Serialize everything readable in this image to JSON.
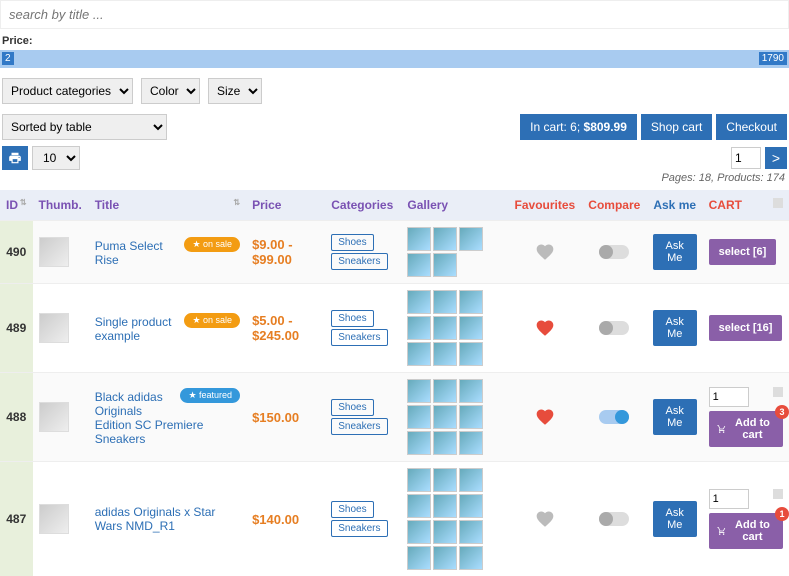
{
  "search": {
    "placeholder": "search by title ..."
  },
  "price": {
    "label": "Price:",
    "min": "2",
    "max": "1790"
  },
  "filters": {
    "categories": "Product categories",
    "color": "Color",
    "size": "Size"
  },
  "sort": "Sorted by table",
  "cart_summary": {
    "text": "In cart: 6; ",
    "price": "$809.99",
    "shop": "Shop cart",
    "checkout": "Checkout"
  },
  "per_page": "10",
  "pagination": {
    "page": "1",
    "go": ">",
    "info": "Pages: 18, Products: 174"
  },
  "columns": {
    "id": "ID",
    "thumb": "Thumb.",
    "title": "Title",
    "price": "Price",
    "categories": "Categories",
    "gallery": "Gallery",
    "favourites": "Favourites",
    "compare": "Compare",
    "askme": "Ask me",
    "cart": "CART"
  },
  "badges": {
    "sale": "★ on sale",
    "featured": "★ featured"
  },
  "cat_tags": {
    "shoes": "Shoes",
    "sneakers": "Sneakers"
  },
  "ask_label": "Ask Me",
  "addcart_label": "Add to cart",
  "rows": [
    {
      "id": "490",
      "title": "Puma Select Rise",
      "price": "$9.00 - $99.00",
      "badge": "sale",
      "gallery_count": 5,
      "fav": false,
      "compare": false,
      "cart_type": "select",
      "select_label": "select [6]"
    },
    {
      "id": "489",
      "title": "Single product example",
      "price": "$5.00 - $245.00",
      "badge": "sale",
      "gallery_count": 9,
      "fav": true,
      "compare": false,
      "cart_type": "select",
      "select_label": "select [16]"
    },
    {
      "id": "488",
      "title": "Black adidas Originals Edition SC Premiere Sneakers",
      "price": "$150.00",
      "badge": "featured",
      "gallery_count": 9,
      "fav": true,
      "compare": true,
      "cart_type": "add",
      "qty": "1",
      "badge_num": "3"
    },
    {
      "id": "487",
      "title": "adidas Originals x Star Wars NMD_R1",
      "price": "$140.00",
      "badge": "",
      "gallery_count": 12,
      "fav": false,
      "compare": false,
      "cart_type": "add",
      "qty": "1",
      "badge_num": "1"
    }
  ]
}
